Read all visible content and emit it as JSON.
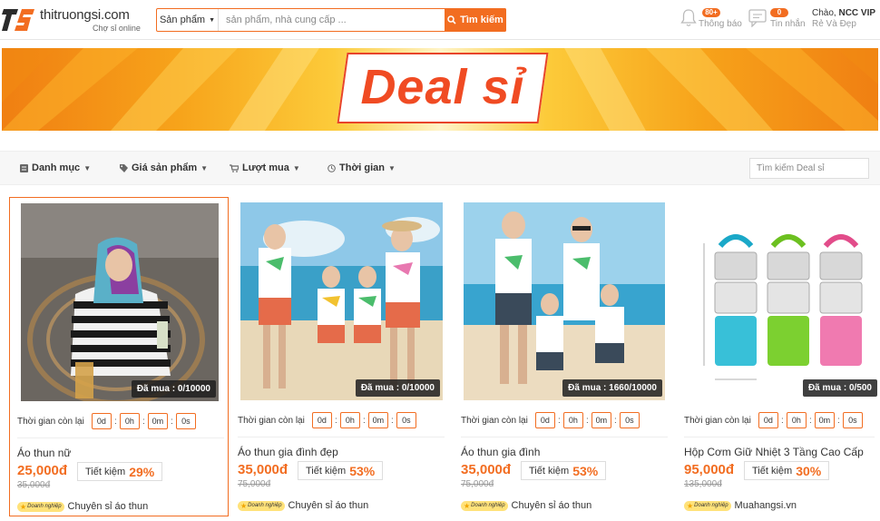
{
  "header": {
    "logo_text": "thitruongsi.com",
    "logo_sub": "Chợ sỉ online",
    "search": {
      "category": "Sản phẩm",
      "placeholder": "sản phẩm, nhà cung cấp ...",
      "button": "Tìm kiếm"
    },
    "notifications": {
      "badge": "80+",
      "label": "Thông báo"
    },
    "messages": {
      "badge": "0",
      "label": "Tin nhắn"
    },
    "greeting": "Chào,",
    "user": "NCC VIP",
    "user_sub": "Rẻ Và Đẹp"
  },
  "banner": {
    "title": "Deal sỉ"
  },
  "filters": {
    "items": [
      {
        "label": "Danh mục",
        "icon": "list-icon"
      },
      {
        "label": "Giá sản phẩm",
        "icon": "tag-icon"
      },
      {
        "label": "Lượt mua",
        "icon": "cart-icon"
      },
      {
        "label": "Thời gian",
        "icon": "clock-icon"
      }
    ],
    "search_placeholder": "Tìm kiếm Deal sỉ"
  },
  "timer_label": "Thời gian còn lại",
  "save_label": "Tiết kiệm",
  "enterprise_badge": "Doanh nghiệp",
  "products": [
    {
      "sold": "Đã mua : 0/10000",
      "timer": [
        "0d",
        "0h",
        "0m",
        "0s"
      ],
      "name": "Áo thun nữ",
      "price": "25,000đ",
      "old_price": "35,000đ",
      "save": "29%",
      "shop": "Chuyên sỉ áo thun"
    },
    {
      "sold": "Đã mua : 0/10000",
      "timer": [
        "0d",
        "0h",
        "0m",
        "0s"
      ],
      "name": "Áo thun gia đình đẹp",
      "price": "35,000đ",
      "old_price": "75,000đ",
      "save": "53%",
      "shop": "Chuyên sỉ áo thun"
    },
    {
      "sold": "Đã mua : 1660/10000",
      "timer": [
        "0d",
        "0h",
        "0m",
        "0s"
      ],
      "name": "Áo thun gia đình",
      "price": "35,000đ",
      "old_price": "75,000đ",
      "save": "53%",
      "shop": "Chuyên sỉ áo thun"
    },
    {
      "sold": "Đã mua : 0/500",
      "timer": [
        "0d",
        "0h",
        "0m",
        "0s"
      ],
      "name": "Hộp Cơm Giữ Nhiệt 3 Tầng Cao Cấp",
      "price": "95,000đ",
      "old_price": "135,000đ",
      "save": "30%",
      "shop": "Muahangsi.vn"
    }
  ],
  "colors": {
    "accent": "#f26d21"
  }
}
